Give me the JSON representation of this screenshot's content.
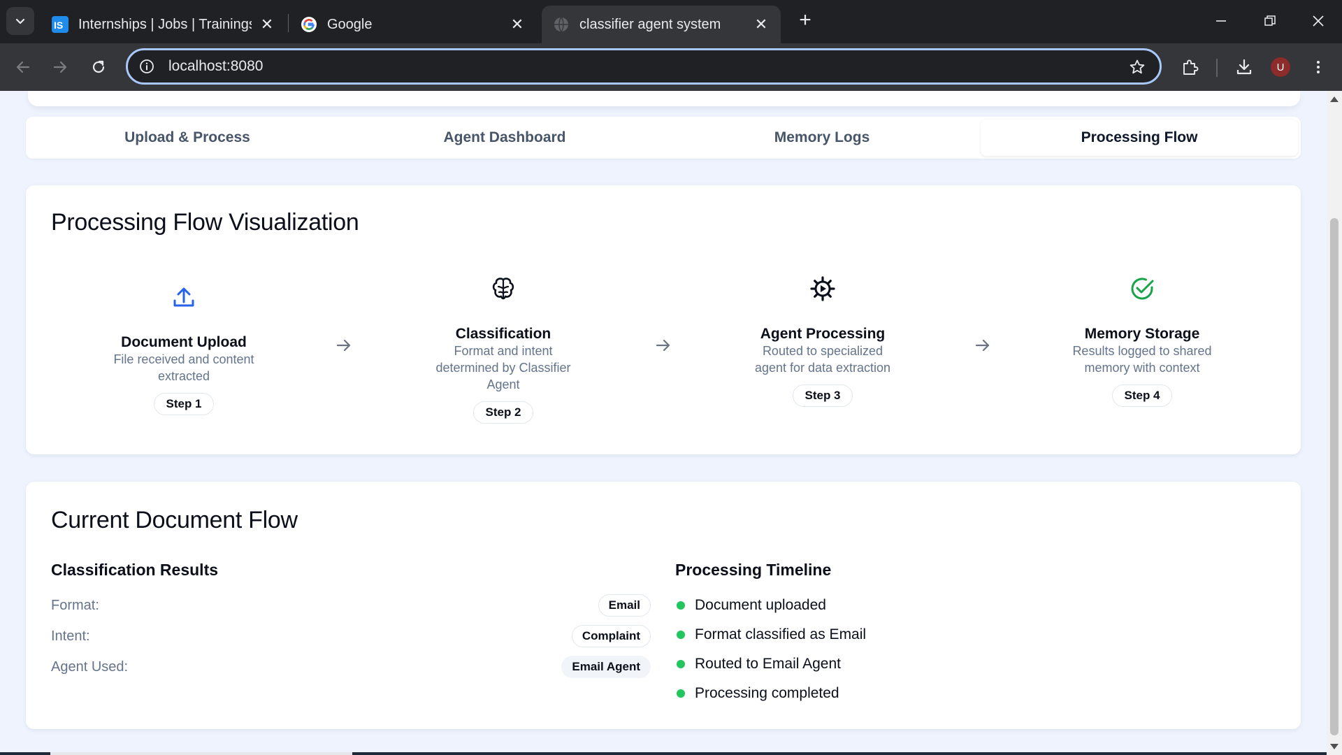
{
  "browser": {
    "tabs": [
      {
        "title": "Internships | Jobs | Trainings & I",
        "favicon": "internshala-icon",
        "active": false
      },
      {
        "title": "Google",
        "favicon": "google-icon",
        "active": false
      },
      {
        "title": "classifier agent system",
        "favicon": "globe-icon",
        "active": true
      }
    ],
    "url": "localhost:8080",
    "profile_initial": "U"
  },
  "app": {
    "tabs": [
      "Upload & Process",
      "Agent Dashboard",
      "Memory Logs",
      "Processing Flow"
    ],
    "active_tab": "Processing Flow"
  },
  "flow": {
    "title": "Processing Flow Visualization",
    "steps": [
      {
        "name": "Document Upload",
        "description": "File received and content extracted",
        "badge": "Step 1",
        "icon": "upload-icon",
        "icon_color": "#2563eb"
      },
      {
        "name": "Classification",
        "description": "Format and intent determined by Classifier Agent",
        "badge": "Step 2",
        "icon": "brain-icon",
        "icon_color": "#0b0f1a"
      },
      {
        "name": "Agent Processing",
        "description": "Routed to specialized agent for data extraction",
        "badge": "Step 3",
        "icon": "gear-icon",
        "icon_color": "#0b0f1a"
      },
      {
        "name": "Memory Storage",
        "description": "Results logged to shared memory with context",
        "badge": "Step 4",
        "icon": "check-circle-icon",
        "icon_color": "#16a34a"
      }
    ]
  },
  "current": {
    "title": "Current Document Flow",
    "classification": {
      "title": "Classification Results",
      "rows": [
        {
          "label": "Format:",
          "value": "Email"
        },
        {
          "label": "Intent:",
          "value": "Complaint"
        },
        {
          "label": "Agent Used:",
          "value": "Email Agent"
        }
      ]
    },
    "timeline": {
      "title": "Processing Timeline",
      "items": [
        "Document uploaded",
        "Format classified as Email",
        "Routed to Email Agent",
        "Processing completed"
      ],
      "dot_color": "#22c55e"
    }
  }
}
